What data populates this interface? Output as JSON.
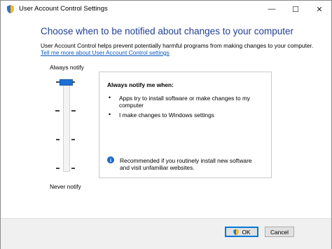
{
  "window": {
    "title": "User Account Control Settings",
    "controls": {
      "minimize": "—",
      "maximize": "☐",
      "close": "✕"
    }
  },
  "main": {
    "heading": "Choose when to be notified about changes to your computer",
    "description": "User Account Control helps prevent potentially harmful programs from making changes to your computer.",
    "link": "Tell me more about User Account Control settings"
  },
  "slider": {
    "top_label": "Always notify",
    "bottom_label": "Never notify",
    "current_level": 4,
    "levels": 4
  },
  "panel": {
    "title": "Always notify me when:",
    "bullets": [
      "Apps try to install software or make changes to my computer",
      "I make changes to Windows settings"
    ],
    "info_text": "Recommended if you routinely install new software and visit unfamiliar websites."
  },
  "footer": {
    "ok_label": "OK",
    "cancel_label": "Cancel"
  },
  "colors": {
    "heading": "#1f3f9a",
    "link": "#0a58c6",
    "accent": "#1e6fd6"
  },
  "icons": {
    "title": "uac-shield-icon",
    "info": "info-icon",
    "ok": "uac-shield-icon"
  }
}
